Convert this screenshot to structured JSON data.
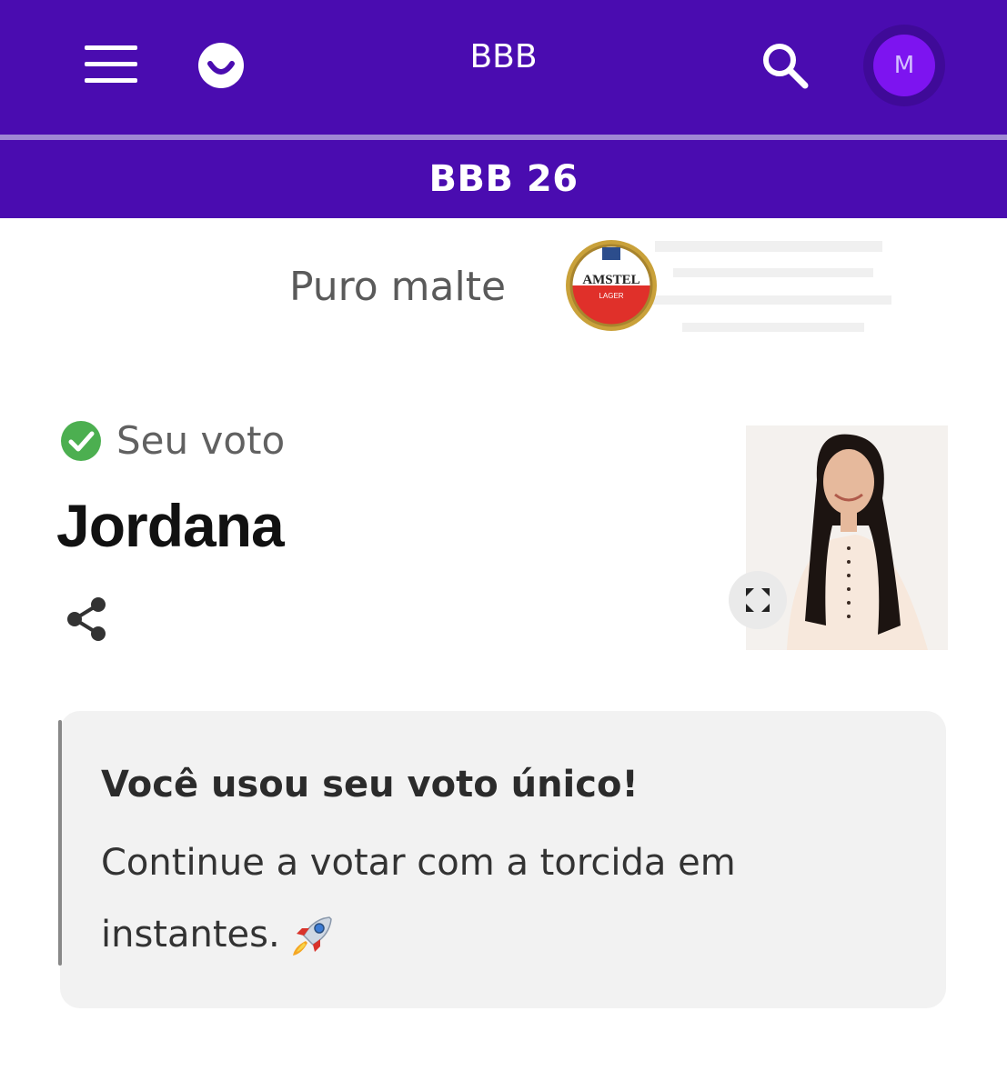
{
  "header": {
    "app_title": "BBB",
    "avatar_initial": "M",
    "subtitle": "BBB 26"
  },
  "sponsor": {
    "tagline": "Puro malte",
    "logo_text": "AMSTEL",
    "logo_subtext": "LAGER"
  },
  "vote": {
    "label": "Seu voto",
    "candidate_name": "Jordana"
  },
  "notice": {
    "title": "Você usou seu voto único!",
    "body": "Continue a votar com a torcida em instantes."
  },
  "colors": {
    "brand_purple": "#4a0cb0",
    "avatar_purple": "#7d14f0",
    "check_green": "#4caf50"
  },
  "icons": [
    "menu-icon",
    "logo-icon",
    "search-icon",
    "check-circle-icon",
    "share-icon",
    "expand-icon",
    "rocket-icon"
  ]
}
